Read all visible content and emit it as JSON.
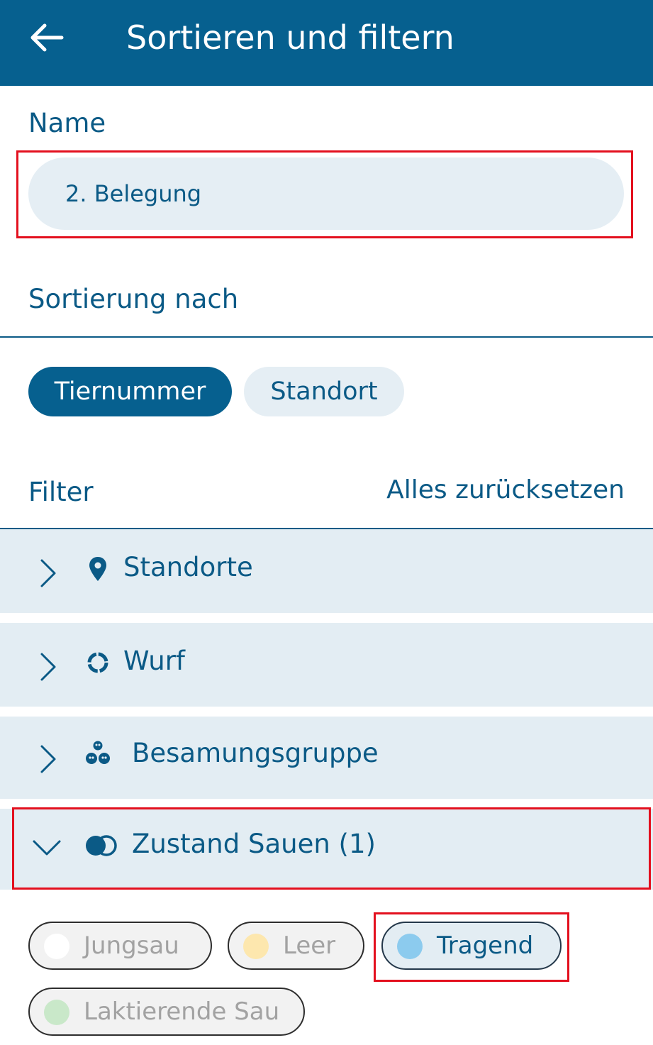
{
  "appbar": {
    "title": "Sortieren und filtern",
    "back_icon": "arrow-left-icon"
  },
  "name_section": {
    "label": "Name",
    "value": "2. Belegung"
  },
  "sort_section": {
    "label": "Sortierung nach",
    "options": [
      {
        "label": "Tiernummer",
        "selected": true
      },
      {
        "label": "Standort",
        "selected": false
      }
    ]
  },
  "filter_section": {
    "label": "Filter",
    "reset_label": "Alles zurücksetzen",
    "groups": [
      {
        "label": "Standorte",
        "icon": "location-pin-icon",
        "expanded": false
      },
      {
        "label": "Wurf",
        "icon": "cycle-icon",
        "expanded": false
      },
      {
        "label": "Besamungsgruppe",
        "icon": "group-icon",
        "expanded": false
      },
      {
        "label": "Zustand Sauen (1)",
        "icon": "toggle-state-icon",
        "expanded": true
      }
    ],
    "sow_states": [
      {
        "label": "Jungsau",
        "color": "#ffffff",
        "selected": false
      },
      {
        "label": "Leer",
        "color": "#fde7ae",
        "selected": false
      },
      {
        "label": "Tragend",
        "color": "#8ccbee",
        "selected": true
      },
      {
        "label": "Laktierende Sau",
        "color": "#c9e8c9",
        "selected": false
      }
    ]
  },
  "colors": {
    "primary": "#06608f",
    "text": "#0b5a86",
    "surface": "#e3edf3",
    "highlight": "#e3101e"
  }
}
